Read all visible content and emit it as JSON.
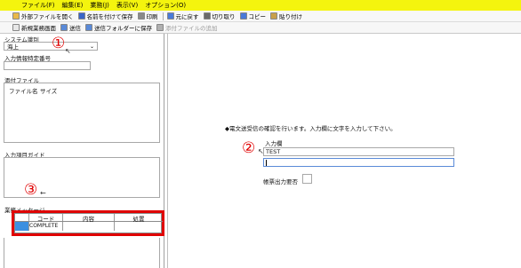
{
  "menu": [
    "ファイル(F)",
    "編集(E)",
    "業務(J)",
    "表示(V)",
    "オプション(O)"
  ],
  "toolbar1": [
    {
      "label": "外部ファイルを開く",
      "icon": "folder-open-icon",
      "color": "#e8b84a"
    },
    {
      "label": "名前を付けて保存",
      "icon": "save-icon",
      "color": "#3a64c8"
    },
    {
      "label": "印刷",
      "icon": "print-icon",
      "color": "#8a8a8a"
    },
    {
      "label": "元に戻す",
      "icon": "undo-icon",
      "color": "#4a7ad8"
    },
    {
      "label": "切り取り",
      "icon": "cut-icon",
      "color": "#6a6a6a"
    },
    {
      "label": "コピー",
      "icon": "copy-icon",
      "color": "#4a7ad8"
    },
    {
      "label": "貼り付け",
      "icon": "paste-icon",
      "color": "#c8a04a"
    }
  ],
  "toolbar2": [
    {
      "label": "新規業務画面",
      "icon": "new-screen-icon",
      "color": "#e8e8e8",
      "enabled": true
    },
    {
      "label": "送信",
      "icon": "send-icon",
      "color": "#5a8ad8",
      "enabled": true
    },
    {
      "label": "送信フォルダーに保存",
      "icon": "save-to-folder-icon",
      "color": "#5a8ad8",
      "enabled": true
    },
    {
      "label": "添付ファイルの追加",
      "icon": "attach-icon",
      "color": "#b0b0b0",
      "enabled": false
    }
  ],
  "left": {
    "system_label": "システム識別",
    "system_value": "海上",
    "input_info_label": "入力情報特定番号",
    "input_info_value": "",
    "attach_label": "添付ファイル",
    "attach_cols": [
      "ファイル名",
      "サイズ"
    ],
    "guide_label": "入力項目ガイド",
    "message_label": "業務メッセージ",
    "message_cols": [
      "コード",
      "内容",
      "処置"
    ],
    "message_row": {
      "code": "COMPLETE",
      "content": "",
      "action": ""
    }
  },
  "main": {
    "instruction": "◆電文送受信の確認を行います。入力欄に文字を入力して下さい。",
    "input_label": "入力欄",
    "input_value1": "TEST",
    "input_value2": "",
    "report_label": "帳票出力要否"
  },
  "markers": {
    "m1": "①",
    "m2": "②",
    "m3": "③"
  },
  "colors": {
    "menubar": "#f4f40e",
    "annotation": "#e00000",
    "selection": "#3c8fe0"
  }
}
